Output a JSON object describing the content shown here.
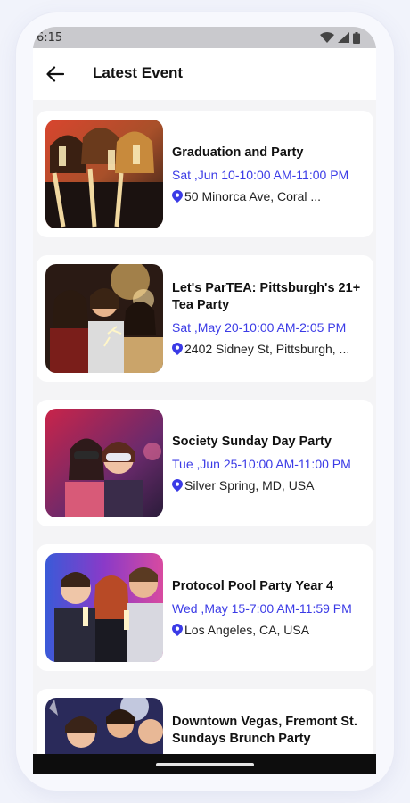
{
  "status_bar": {
    "time": "6:15"
  },
  "header": {
    "title": "Latest Event",
    "back_icon": "arrow-left-icon"
  },
  "events": [
    {
      "title": "Graduation and Party",
      "date": "Sat ,Jun 10-10:00 AM-11:00 PM",
      "location": "50 Minorca Ave, Coral ..."
    },
    {
      "title": "Let's ParTEA: Pittsburgh's 21+ Tea Party",
      "date": "Sat ,May 20-10:00 AM-2:05 PM",
      "location": "2402 Sidney St, Pittsburgh, ..."
    },
    {
      "title": "Society Sunday Day Party",
      "date": "Tue ,Jun 25-10:00 AM-11:00 PM",
      "location": "Silver Spring, MD, USA"
    },
    {
      "title": "Protocol Pool Party Year 4",
      "date": "Wed ,May 15-7:00 AM-11:59 PM",
      "location": "Los Angeles, CA, USA"
    },
    {
      "title": "Downtown Vegas, Fremont St. Sundays Brunch Party",
      "date": "",
      "location": ""
    }
  ],
  "colors": {
    "accent": "#3b3be6",
    "title": "#111111",
    "background": "#f4f4f6"
  }
}
